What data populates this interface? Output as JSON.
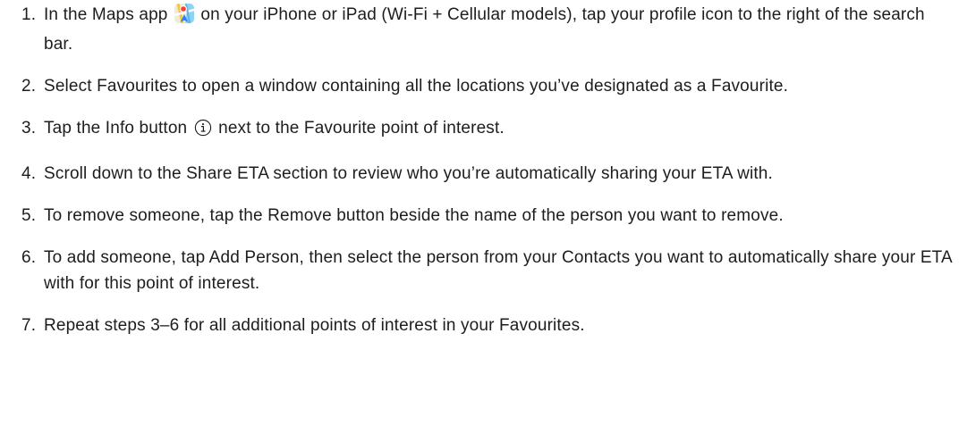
{
  "steps": [
    {
      "number": "1.",
      "text_before": "In the Maps app",
      "icon": "maps-app-icon",
      "text_after": "on your iPhone or iPad (Wi-Fi + Cellular models), tap your profile icon to the right of the search bar."
    },
    {
      "number": "2.",
      "text": "Select Favourites to open a window containing all the locations you’ve designated as a Favourite."
    },
    {
      "number": "3.",
      "text_before": "Tap the Info button",
      "icon": "info-icon",
      "text_after": "next to the Favourite point of interest."
    },
    {
      "number": "4.",
      "text": "Scroll down to the Share ETA section to review who you’re automatically sharing your ETA with."
    },
    {
      "number": "5.",
      "text": "To remove someone, tap the Remove button beside the name of the person you want to remove."
    },
    {
      "number": "6.",
      "text": "To add someone, tap Add Person, then select the person from your Contacts you want to automatically share your ETA with for this point of interest."
    },
    {
      "number": "7.",
      "text": "Repeat steps 3–6 for all additional points of interest in your Favourites."
    }
  ]
}
